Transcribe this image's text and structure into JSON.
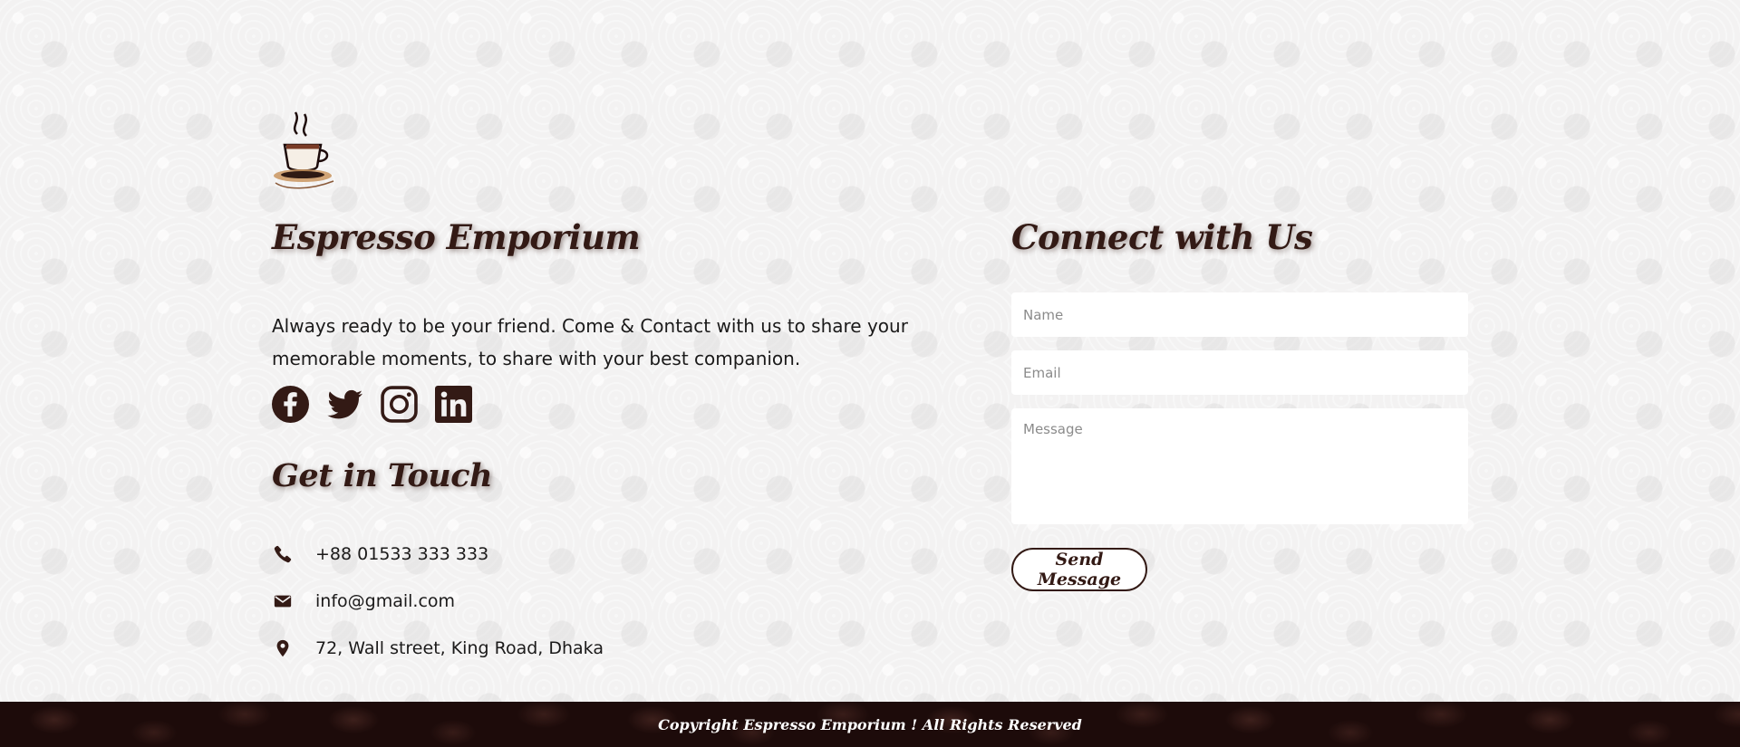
{
  "brand": {
    "logo_icon": "coffee-cup-logo",
    "name": "Espresso Emporium",
    "description": "Always ready to be your friend. Come & Contact with us to share your memorable moments, to share with your best companion."
  },
  "socials": [
    {
      "icon": "facebook-icon"
    },
    {
      "icon": "twitter-icon"
    },
    {
      "icon": "instagram-icon"
    },
    {
      "icon": "linkedin-icon"
    }
  ],
  "get_in_touch": {
    "title": "Get in Touch",
    "phone": "+88 01533 333 333",
    "email": "info@gmail.com",
    "address": "72, Wall street, King Road, Dhaka"
  },
  "connect": {
    "title": "Connect with Us",
    "name_placeholder": "Name",
    "email_placeholder": "Email",
    "message_placeholder": "Message",
    "send_label": "Send Message"
  },
  "footer": {
    "copyright": "Copyright Espresso Emporium ! All Rights Reserved"
  },
  "colors": {
    "brand_dark": "#331a15",
    "footer_bg": "#1d0b0a",
    "page_bg": "#f3f2f2"
  }
}
